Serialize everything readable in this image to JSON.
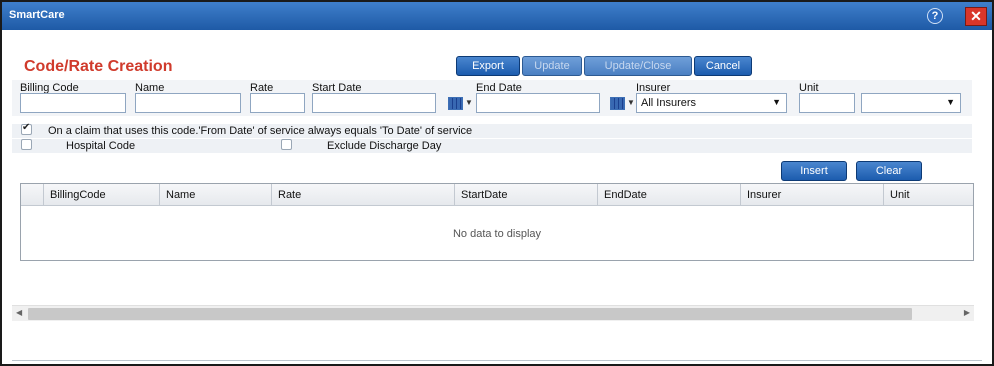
{
  "window": {
    "title": "SmartCare",
    "help_symbol": "?",
    "close_symbol": "✕"
  },
  "page": {
    "title": "Code/Rate Creation"
  },
  "toolbar": {
    "export": "Export",
    "update": "Update",
    "update_close": "Update/Close",
    "cancel": "Cancel"
  },
  "fields": {
    "billing_code": {
      "label": "Billing Code",
      "value": ""
    },
    "name": {
      "label": "Name",
      "value": ""
    },
    "rate": {
      "label": "Rate",
      "value": ""
    },
    "start_date": {
      "label": "Start Date",
      "value": ""
    },
    "end_date": {
      "label": "End Date",
      "value": ""
    },
    "insurer": {
      "label": "Insurer",
      "value": "All Insurers"
    },
    "unit": {
      "label": "Unit",
      "value": "",
      "type_value": ""
    }
  },
  "options": {
    "from_equals_to": {
      "label": "On a claim that uses this code.'From Date' of service always equals 'To Date' of service",
      "checked": true
    },
    "hospital_code": {
      "label": "Hospital Code",
      "checked": false
    },
    "exclude_discharge": {
      "label": "Exclude Discharge Day",
      "checked": false
    }
  },
  "actions": {
    "insert": "Insert",
    "clear": "Clear"
  },
  "grid": {
    "columns": [
      "BillingCode",
      "Name",
      "Rate",
      "StartDate",
      "EndDate",
      "Insurer",
      "Unit"
    ],
    "empty_text": "No data to display"
  },
  "icons": {
    "dropdown_arrow": "▼",
    "scroll_left": "◀",
    "scroll_right": "▶"
  },
  "colors": {
    "titlebar": "#2a69b8",
    "page_title": "#d03b2c",
    "button": "#1c5cae"
  }
}
